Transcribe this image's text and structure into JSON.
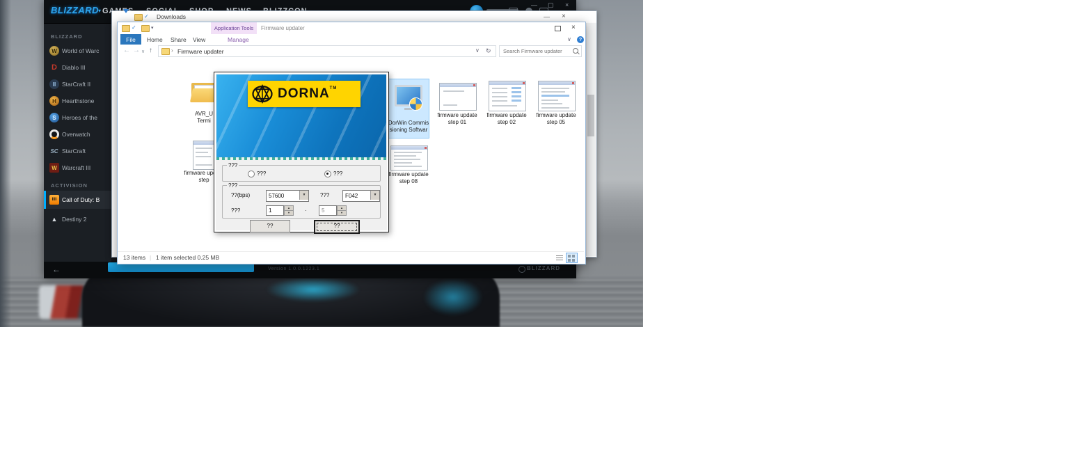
{
  "colors": {
    "launcher_accent": "#00aeff",
    "cod_orange": "#ff9d00",
    "file_tab_blue": "#2b77bd",
    "app_tools_purple": "#f2e0f7",
    "selection_blue": "#cce8ff",
    "dorna_blue": "#1286cf",
    "dorna_yellow": "#ffd400",
    "progress_blue": "#1a9bd7"
  },
  "launcher": {
    "brand": "BLIZZARD",
    "brand_caret": "▾",
    "menu": [
      "GAMES",
      "SOCIAL",
      "SHOP",
      "NEWS",
      "BLIZZCON"
    ],
    "window_controls": {
      "minimize": "—",
      "maximize": "▢",
      "close": "×"
    },
    "sidebar": {
      "section1_header": "BLIZZARD",
      "items1": [
        {
          "label": "World of Warc",
          "glyph": "W"
        },
        {
          "label": "Diablo III",
          "glyph": "D"
        },
        {
          "label": "StarCraft II",
          "glyph": "II"
        },
        {
          "label": "Hearthstone",
          "glyph": "H"
        },
        {
          "label": "Heroes of the",
          "glyph": "S"
        },
        {
          "label": "Overwatch",
          "glyph": ""
        },
        {
          "label": "StarCraft",
          "glyph": "SC"
        },
        {
          "label": "Warcraft III",
          "glyph": "W"
        }
      ],
      "section2_header": "ACTIVISION",
      "items2": [
        {
          "label": "Call of Duty: B",
          "glyph": "IIII"
        },
        {
          "label": "Destiny 2",
          "glyph": "▲"
        }
      ]
    },
    "footer": {
      "back": "←",
      "version": "Version 1.0.0.1223.1",
      "brand": "BLIZZARD"
    }
  },
  "downloads_window": {
    "title": "Downloads",
    "minimize": "—",
    "close": "×",
    "check": "✓"
  },
  "explorer": {
    "app_tools_tab": "Application Tools",
    "title": "Firmware updater",
    "tabs": {
      "file": "File",
      "home": "Home",
      "share": "Share",
      "view": "View",
      "manage": "Manage"
    },
    "ribbon_chevron": "∨",
    "help": "?",
    "close": "×",
    "nav": {
      "back": "←",
      "forward": "→",
      "drop": "∨",
      "up": "↑"
    },
    "address": {
      "chevron": "›",
      "path": "Firmware updater",
      "dropdown": "∨",
      "refresh": "↻",
      "search_placeholder": "Search Firmware updater"
    },
    "files": {
      "avr": {
        "line1": "AVR_U",
        "line2": "Termi"
      },
      "card_dots": "• • • •",
      "dorwin": {
        "line1": "DorWin Commis",
        "line2": "sioning Softwar"
      },
      "step01": {
        "line1": "firmware update",
        "line2": "step 01"
      },
      "step02": {
        "line1": "firmware update",
        "line2": "step 02"
      },
      "step05": {
        "line1": "firmware update",
        "line2": "step 05"
      },
      "partial": {
        "line1": "firmware update",
        "line2": "step"
      },
      "step08": {
        "line1": "firmware update",
        "line2": "step 08"
      }
    },
    "status": {
      "items": "13 items",
      "divider": "|",
      "selection": "1 item selected  0.25 MB"
    }
  },
  "dorna": {
    "brand": "DORNA",
    "tm": "TM",
    "conn_group": {
      "label": "???",
      "radio_a": "???",
      "radio_b": "???"
    },
    "param_group": {
      "label": "???",
      "baud_label": "??(bps)",
      "baud_value": "57600",
      "port_label": "???",
      "port_value": "F042",
      "id_label": "???",
      "id_value": "1",
      "dot": "·",
      "axis_value": "5",
      "arrow": "▼",
      "up": "▲",
      "down": "▼"
    },
    "btn_left": "??",
    "btn_right": "??"
  }
}
